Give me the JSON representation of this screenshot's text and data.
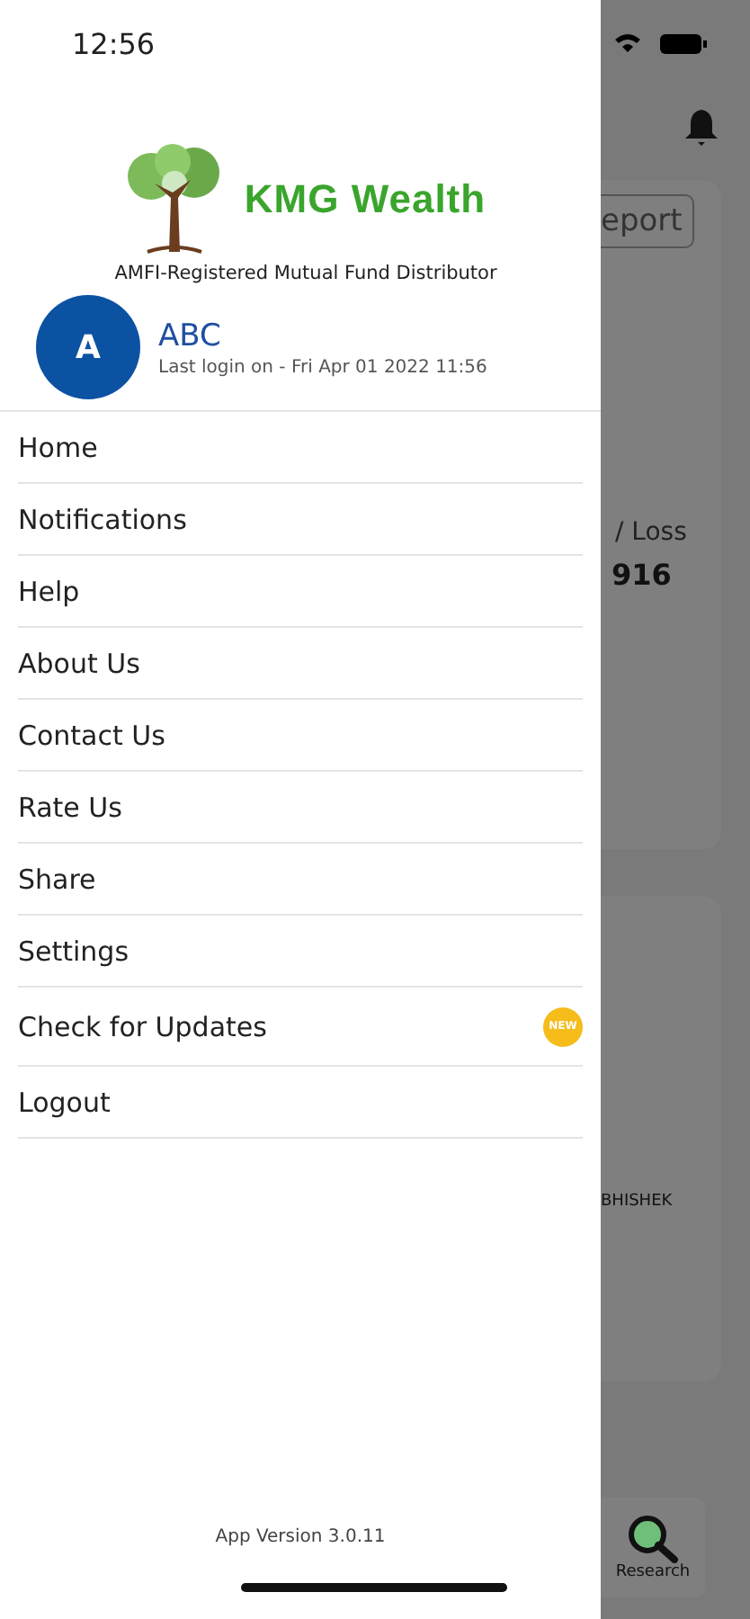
{
  "status_bar": {
    "time": "12:56"
  },
  "drawer": {
    "brand": "KMG Wealth",
    "tagline": "AMFI-Registered Mutual Fund Distributor",
    "user": {
      "initial": "A",
      "name": "ABC",
      "last_login": "Last login on - Fri Apr 01 2022 11:56"
    },
    "items": [
      {
        "label": "Home"
      },
      {
        "label": "Notifications"
      },
      {
        "label": "Help"
      },
      {
        "label": "About Us"
      },
      {
        "label": "Contact Us"
      },
      {
        "label": "Rate Us"
      },
      {
        "label": "Share"
      },
      {
        "label": "Settings"
      },
      {
        "label": "Check for Updates",
        "badge": "NEW"
      },
      {
        "label": "Logout"
      }
    ],
    "version": "App Version 3.0.11"
  },
  "background": {
    "report_button": "eport",
    "profit_label": "/ Loss",
    "profit_value": "916",
    "name": "BHISHEK",
    "research_tab": "Research"
  }
}
